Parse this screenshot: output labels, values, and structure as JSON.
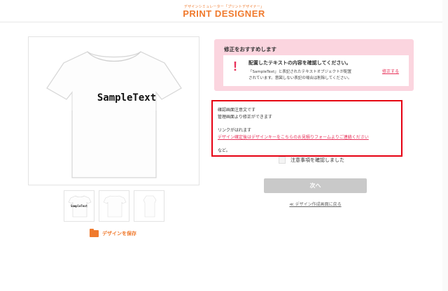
{
  "header": {
    "logo_sub": "デザインシミュレーター「プリントデザイナー」",
    "logo_main": "PRINT DESIGNER"
  },
  "preview": {
    "sample_text": "SampleText"
  },
  "thumbnails": [
    {
      "text": "SampleText"
    },
    {
      "text": ""
    },
    {
      "text": ""
    }
  ],
  "save": {
    "label": "デザインを保存"
  },
  "notice": {
    "title": "修正をおすすめします",
    "mark": "!",
    "heading": "配置したテキストの内容を確認してください。",
    "body_line1": "「SampleText」と表記されたテキストオブジェクトが配置",
    "body_line2": "されています。意図しない表記の場合は削除してください。",
    "fix_link": "修正する"
  },
  "attention": {
    "line1": "確認画面注意文です",
    "line2": "管理画面より修正ができます",
    "line3": "リンクがはれます",
    "link": "デザイン確定後はデザインキーをこちらのお見積りフォームよりご連絡ください",
    "line4": "など。"
  },
  "confirm": {
    "label": "注意事項を確認しました"
  },
  "next_button": "次へ",
  "back_link": "≪ デザイン作成画面に戻る",
  "colors": {
    "brand": "#f07a2d",
    "notice_bg": "#fbd5df",
    "alert": "#e8325a",
    "frame": "#e60012"
  }
}
